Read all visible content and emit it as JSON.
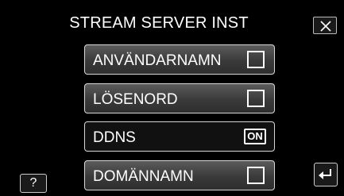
{
  "screen": {
    "title": "STREAM SERVER INST"
  },
  "icons": {
    "close": "close-icon",
    "help": "help-icon",
    "back": "back-arrow-icon"
  },
  "help_label": "?",
  "menu": [
    {
      "label": "ANVÄNDARNAMN",
      "control": "checkbox"
    },
    {
      "label": "LÖSENORD",
      "control": "checkbox"
    },
    {
      "label": "DDNS",
      "control": "toggle",
      "value": "ON"
    },
    {
      "label": "DOMÄNNAMN",
      "control": "checkbox"
    }
  ]
}
